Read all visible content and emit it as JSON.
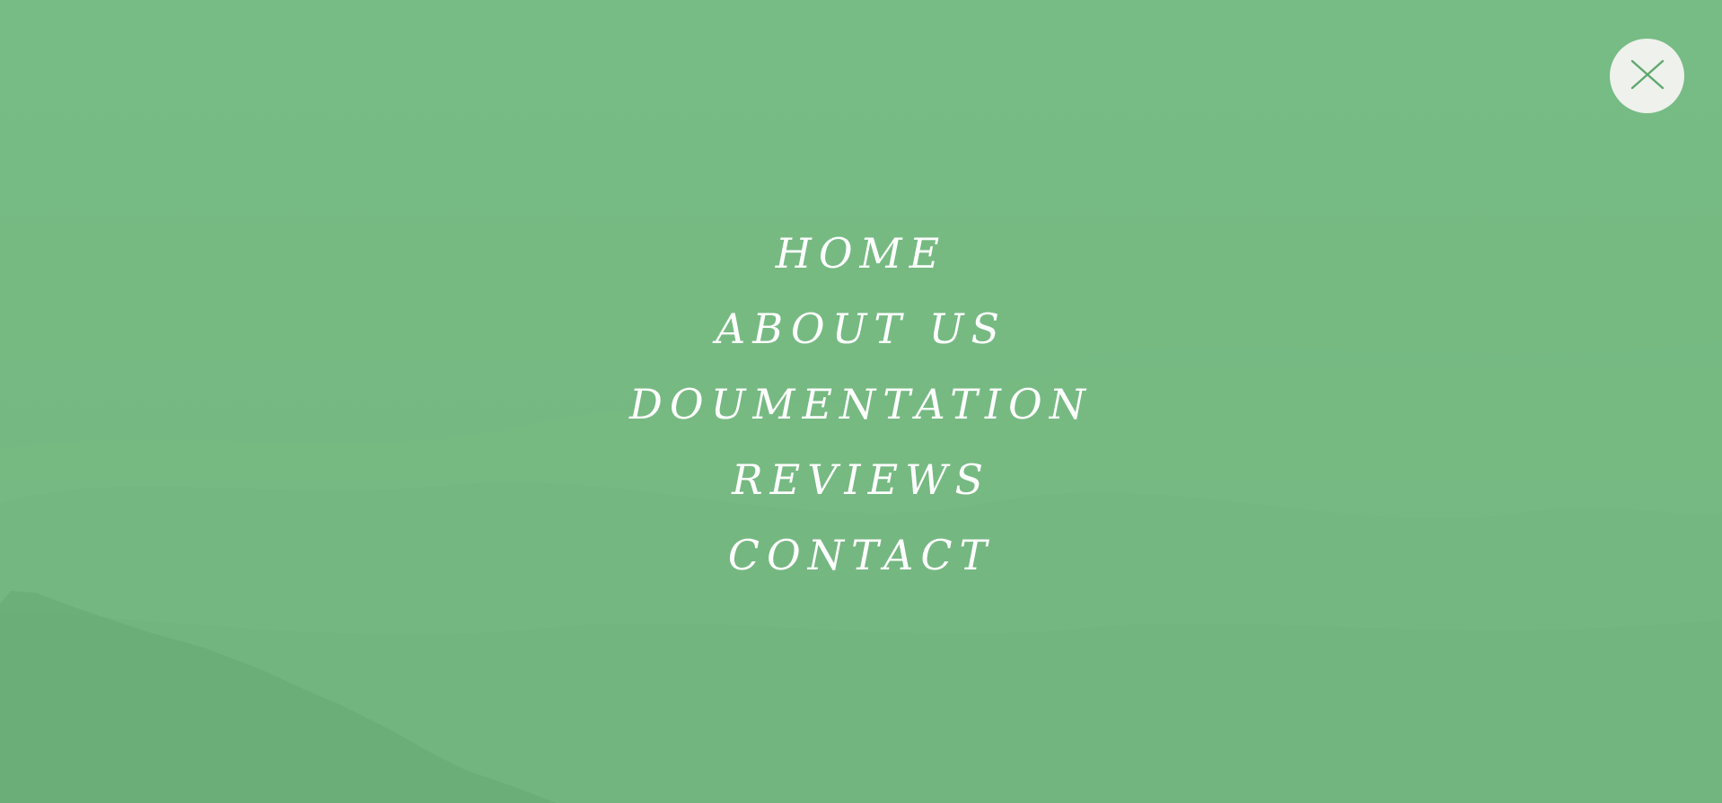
{
  "theme": {
    "background": "#76ba82",
    "mountain_dark": "#6aac76",
    "mountain_light": "#7dc08a",
    "close_button_bg": "#eef1ec",
    "close_icon_color": "#5fa86e",
    "menu_text": "#ffffff"
  },
  "close_button": {
    "icon": "close-icon"
  },
  "menu": {
    "items": [
      {
        "label": "HOME"
      },
      {
        "label": "ABOUT US"
      },
      {
        "label": "DOUMENTATION"
      },
      {
        "label": "REVIEWS"
      },
      {
        "label": "CONTACT"
      }
    ]
  }
}
